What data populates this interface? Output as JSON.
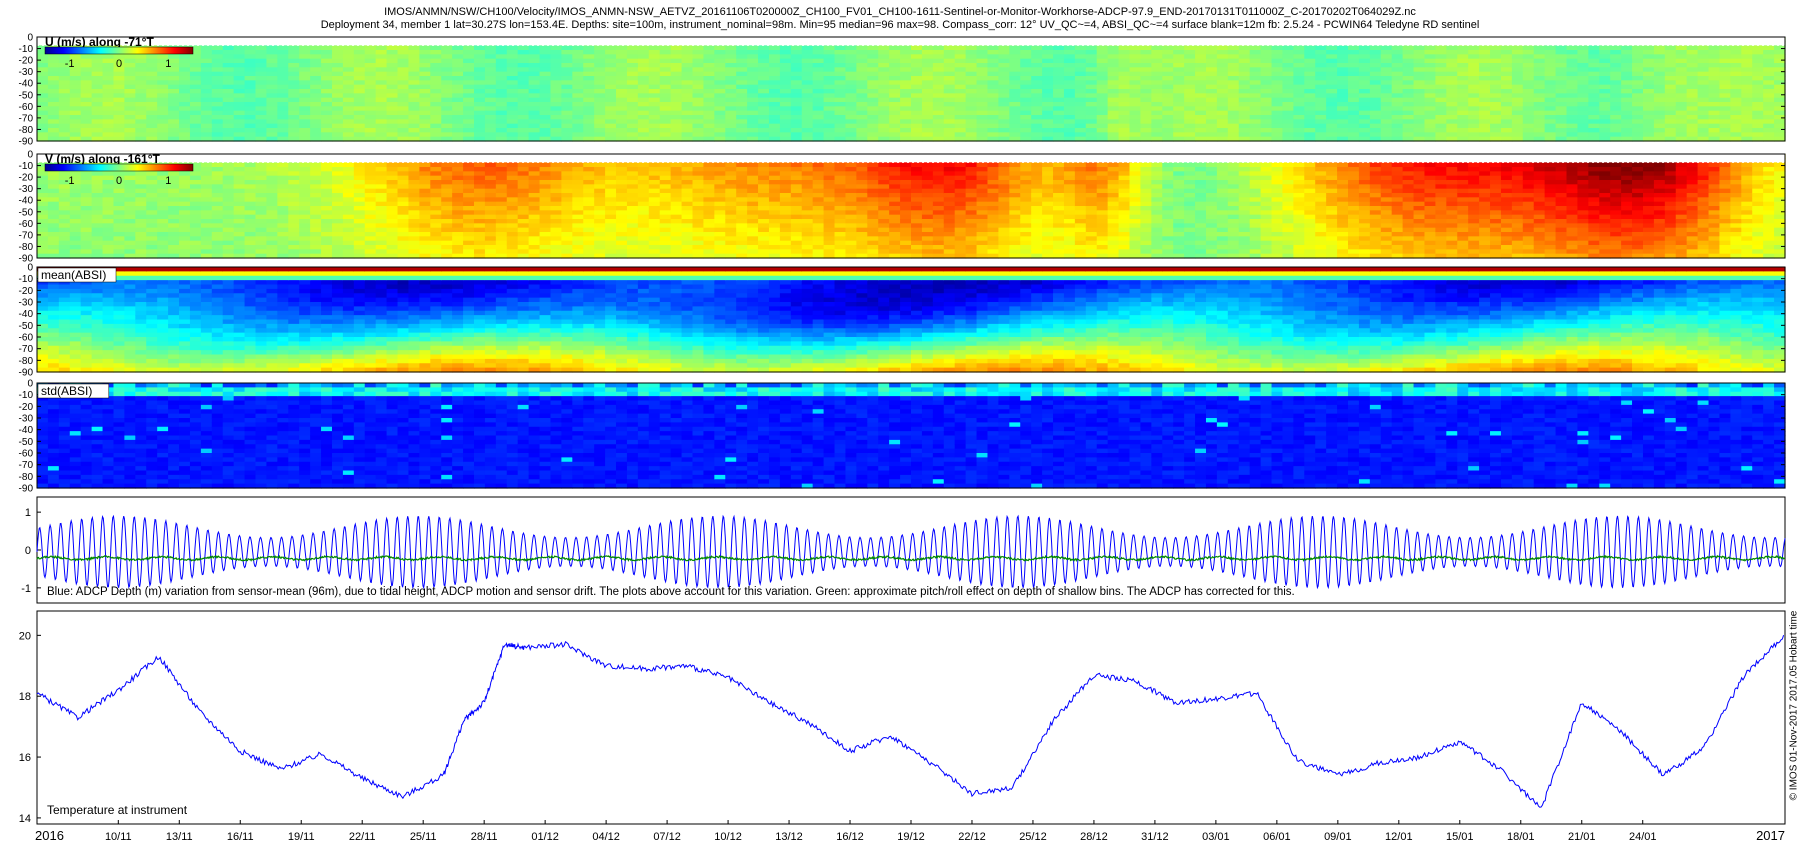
{
  "header": {
    "line1": "IMOS/ANMN/NSW/CH100/Velocity/IMOS_ANMN-NSW_AETVZ_20161106T020000Z_CH100_FV01_CH100-1611-Sentinel-or-Monitor-Workhorse-ADCP-97.9_END-20170131T011000Z_C-20170202T064029Z.nc",
    "line2": "Deployment 34, member 1 lat=30.27S lon=153.4E. Depths: site=100m, instrument_nominal=98m. Min=95 median=96 max=98. Compass_corr: 12° UV_QC~=4, ABSI_QC~=4 surface blank=12m fb: 2.5.24 - PCWIN64 Teledyne RD sentinel"
  },
  "side_label": "© IMOS 01-Nov-2017 2017.05 Hobart time",
  "colors": {
    "blue_line": "#0000ff",
    "green_line": "#008800"
  },
  "chart_data": [
    {
      "type": "heatmap",
      "title": "U (m/s) along -71°T",
      "ylabel": "",
      "ylim": [
        -90,
        0
      ],
      "y_ticks": [
        "0",
        "-10",
        "-20",
        "-30",
        "-40",
        "-50",
        "-60",
        "-70",
        "-80",
        "-90"
      ],
      "colorbar": {
        "ticks": [
          "-1",
          "0",
          "1"
        ],
        "range": [
          -1.5,
          1.5
        ],
        "colormap": "jet"
      },
      "pattern": {
        "mean_value": 0.05,
        "near_zero": true
      }
    },
    {
      "type": "heatmap",
      "title": "V (m/s) along -161°T",
      "ylim": [
        -90,
        0
      ],
      "y_ticks": [
        "0",
        "-10",
        "-20",
        "-30",
        "-40",
        "-50",
        "-60",
        "-70",
        "-80",
        "-90"
      ],
      "colorbar": {
        "ticks": [
          "-1",
          "0",
          "1"
        ],
        "range": [
          -1.5,
          1.5
        ],
        "colormap": "jet"
      },
      "pattern": {
        "strong_positive_periods": [
          "2016-11-12 to 2016-11-22",
          "2016-12-14 to 2016-12-20",
          "2016-12-24 to 2016-12-27",
          "2017-01-12 to 2017-01-27"
        ]
      }
    },
    {
      "type": "heatmap",
      "title": "mean(ABSI)",
      "ylim": [
        -90,
        0
      ],
      "y_ticks": [
        "0",
        "-10",
        "-20",
        "-30",
        "-40",
        "-50",
        "-60",
        "-70",
        "-80",
        "-90"
      ]
    },
    {
      "type": "heatmap",
      "title": "std(ABSI)",
      "ylim": [
        -90,
        0
      ],
      "y_ticks": [
        "0",
        "-10",
        "-20",
        "-30",
        "-40",
        "-50",
        "-60",
        "-70",
        "-80",
        "-90"
      ]
    },
    {
      "type": "line",
      "ylim": [
        -1.4,
        1.4
      ],
      "y_ticks": [
        "1",
        "0",
        "-1"
      ],
      "annotation": "Blue: ADCP Depth (m) variation from sensor-mean (96m), due to tidal height, ADCP motion and sensor drift. The plots above account for this variation. Green: approximate pitch/roll effect on depth of shallow bins. The ADCP has corrected for this.",
      "series": [
        {
          "color": "#0000ff",
          "tidal_amplitude_range_m": [
            0.4,
            1.0
          ],
          "period_hours": 12.42
        },
        {
          "color": "#008800",
          "mean_m": -0.22
        }
      ]
    },
    {
      "type": "line",
      "ylim": [
        13.8,
        20.8
      ],
      "y_ticks": [
        "20",
        "18",
        "16",
        "14"
      ],
      "annotation": "Temperature at instrument",
      "x_range_days": [
        0,
        86
      ],
      "series": [
        {
          "color": "#0000ff",
          "x": [
            0,
            2,
            4,
            6,
            8,
            10,
            12,
            14,
            16,
            18,
            20,
            21,
            22,
            23,
            24,
            26,
            28,
            30,
            32,
            34,
            36,
            38,
            40,
            42,
            44,
            46,
            48,
            50,
            52,
            54,
            56,
            58,
            60,
            62,
            64,
            66,
            68,
            70,
            72,
            74,
            76,
            78,
            80,
            82,
            84,
            86
          ],
          "y": [
            18.1,
            17.3,
            18.2,
            19.3,
            17.5,
            16.2,
            15.6,
            16.1,
            15.3,
            14.7,
            15.4,
            17.2,
            17.8,
            19.7,
            19.6,
            19.7,
            19.0,
            18.9,
            19.0,
            18.6,
            17.8,
            17.1,
            16.2,
            16.7,
            15.8,
            14.8,
            15.0,
            17.2,
            18.7,
            18.5,
            17.8,
            17.9,
            18.1,
            15.9,
            15.4,
            15.8,
            16.0,
            16.5,
            15.6,
            14.3,
            17.8,
            16.8,
            15.4,
            16.3,
            18.7,
            20.0
          ]
        }
      ]
    }
  ],
  "x_axis": {
    "start_label": "2016",
    "end_label": "2017",
    "tick_labels": [
      "10/11",
      "13/11",
      "16/11",
      "19/11",
      "22/11",
      "25/11",
      "28/11",
      "01/12",
      "04/12",
      "07/12",
      "10/12",
      "13/12",
      "16/12",
      "19/12",
      "22/12",
      "25/12",
      "28/12",
      "31/12",
      "03/01",
      "06/01",
      "09/01",
      "12/01",
      "15/01",
      "18/01",
      "21/01",
      "24/01"
    ]
  }
}
